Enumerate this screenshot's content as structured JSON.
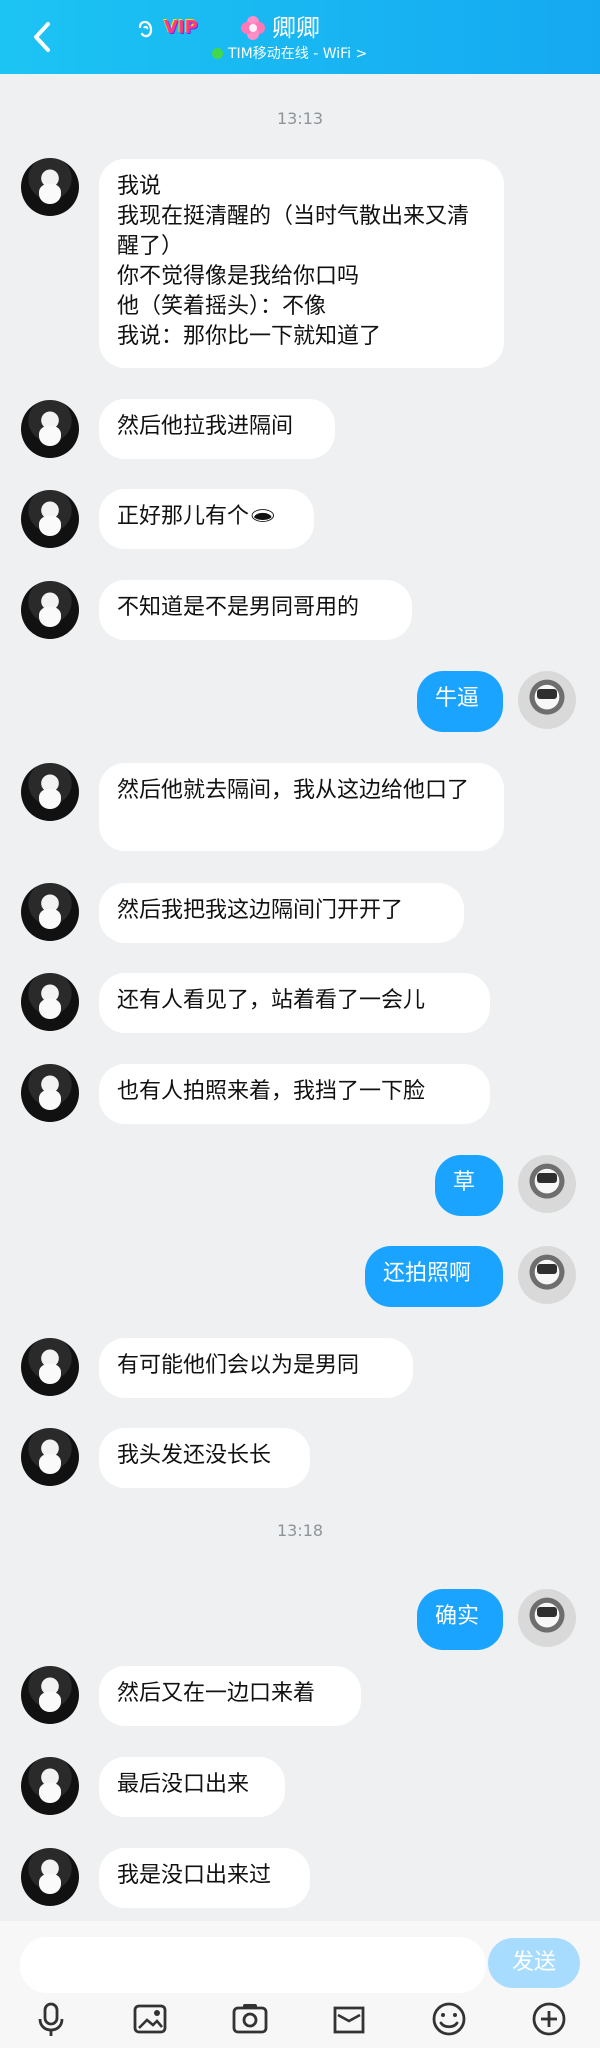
{
  "header": {
    "vip": "VIP",
    "title": "卿卿",
    "status": "TIM移动在线 - WiFi >"
  },
  "icons": {
    "back": "back-icon",
    "ear": "ear-icon",
    "flower": "flower-icon",
    "mic": "microphone-icon",
    "image": "image-icon",
    "camera": "camera-icon",
    "file": "file-icon",
    "emoji": "emoji-icon",
    "plus": "plus-icon"
  },
  "times": {
    "t1": "13:13",
    "t2": "13:18"
  },
  "messages": {
    "m1": "我说\n我现在挺清醒的（当时气散出来又清醒了）\n你不觉得像是我给你口吗\n他（笑着摇头）：不像\n我说：那你比一下就知道了",
    "m2": "然后他拉我进隔间",
    "m3": "正好那儿有个🕳",
    "m4": "不知道是不是男同哥用的",
    "m5": "牛逼",
    "m6": "然后他就去隔间，我从这边给他口了",
    "m7": "然后我把我这边隔间门开开了",
    "m8": "还有人看见了，站着看了一会儿",
    "m9": "也有人拍照来着，我挡了一下脸",
    "m10": "草",
    "m11": "还拍照啊",
    "m12": "有可能他们会以为是男同",
    "m13": "我头发还没长长",
    "m14": "确实",
    "m15": "然后又在一边口来着",
    "m16": "最后没口出来",
    "m17": "我是没口出来过"
  },
  "composer": {
    "placeholder": "",
    "send_label": "发送"
  },
  "colors": {
    "header_start": "#1cc4f3",
    "header_end": "#15a9f1",
    "my_bubble": "#1aa3ff",
    "background": "#eef0f2"
  }
}
